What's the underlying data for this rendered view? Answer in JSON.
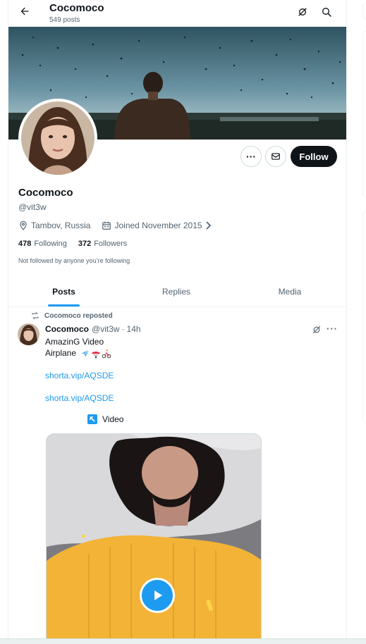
{
  "header": {
    "title": "Cocomoco",
    "post_count": "549 posts"
  },
  "profile": {
    "name": "Cocomoco",
    "handle": "@vit3w",
    "location": "Tambov, Russia",
    "joined": "Joined November 2015",
    "following_count": "478",
    "following_label": "Following",
    "followers_count": "372",
    "followers_label": "Followers",
    "not_followed_text": "Not followed by anyone you’re following"
  },
  "actions": {
    "more_label": "···",
    "follow_label": "Follow"
  },
  "tabs": [
    {
      "label": "Posts",
      "active": true
    },
    {
      "label": "Replies",
      "active": false
    },
    {
      "label": "Media",
      "active": false
    }
  ],
  "post": {
    "repost_text": "Cocomoco reposted",
    "author_name": "Cocomoco",
    "author_handle": "@vit3w",
    "separator": "·",
    "time": "14h",
    "more_label": "···",
    "line1": "AmazinG Video",
    "line2": "Airplane",
    "emojis": [
      "airplane-emoji",
      "parachute-emoji",
      "cyclist-emoji"
    ],
    "link1": "shorta.vip/AQSDE",
    "link2": "shorta.vip/AQSDE",
    "video_label": "Video"
  },
  "colors": {
    "accent": "#1d9bf0",
    "text": "#0f1419",
    "secondary": "#536471",
    "follow_bg": "#0f1419"
  },
  "icons": {
    "back": "arrow-left-icon",
    "grok": "grok-icon",
    "search": "search-icon",
    "message": "envelope-icon",
    "location": "location-pin-icon",
    "calendar": "calendar-icon",
    "repost": "repost-icon",
    "video": "arrow-icon",
    "play": "play-icon"
  }
}
